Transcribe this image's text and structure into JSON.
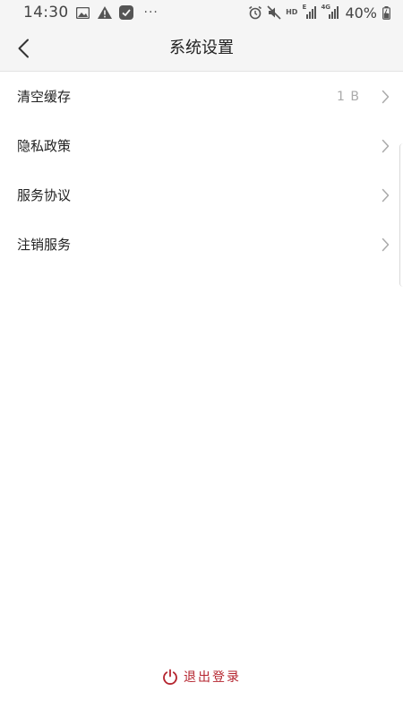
{
  "status_bar": {
    "time": "14:30",
    "more": "···",
    "network_hd": "HD",
    "network_e": "E",
    "network_4g": "4G",
    "battery": "40%",
    "icons": [
      "image-icon",
      "warning-icon",
      "app-icon",
      "alarm-icon",
      "mute-icon",
      "signal-icon",
      "battery-icon"
    ]
  },
  "header": {
    "title": "系统设置",
    "back_icon": "chevron-left-icon"
  },
  "settings": {
    "items": [
      {
        "label": "清空缓存",
        "value": "1 B"
      },
      {
        "label": "隐私政策"
      },
      {
        "label": "服务协议"
      },
      {
        "label": "注销服务"
      }
    ]
  },
  "footer": {
    "logout_label": "退出登录",
    "logout_icon": "power-icon"
  },
  "colors": {
    "accent": "#b5252f",
    "header_bg": "#f5f5f5",
    "text_primary": "#222222",
    "text_secondary": "#aaaaaa"
  }
}
